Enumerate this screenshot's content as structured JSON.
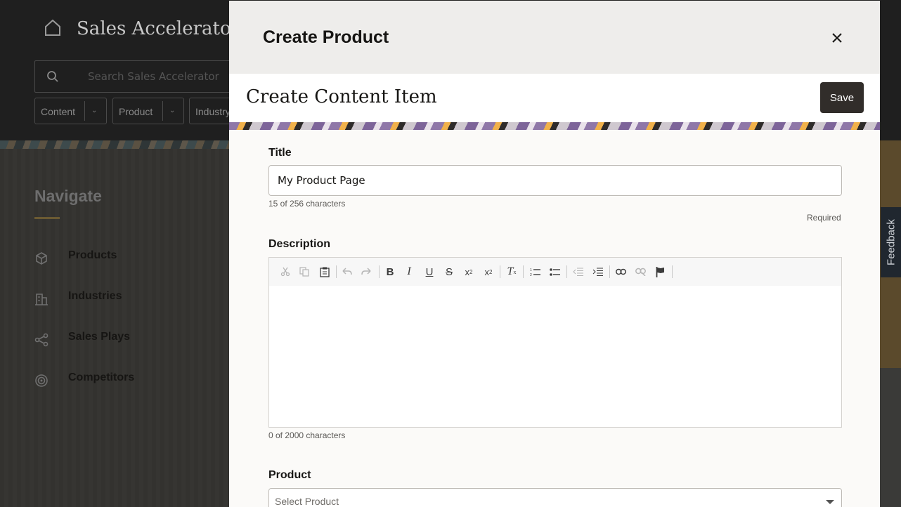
{
  "background": {
    "app_title": "Sales Accelerator",
    "search_placeholder": "Search Sales Accelerator",
    "filters": [
      {
        "label": "Content"
      },
      {
        "label": "Product"
      },
      {
        "label": "Industry"
      }
    ],
    "nav": {
      "title": "Navigate",
      "items": [
        {
          "label": "Products",
          "icon": "cube-icon"
        },
        {
          "label": "Industries",
          "icon": "building-icon"
        },
        {
          "label": "Sales Plays",
          "icon": "share-icon"
        },
        {
          "label": "Competitors",
          "icon": "target-icon"
        }
      ]
    },
    "feedback_label": "Feedback"
  },
  "modal": {
    "title": "Create Product",
    "close_icon": "close-icon",
    "content_item": {
      "heading": "Create Content Item",
      "save_label": "Save"
    },
    "form": {
      "title": {
        "label": "Title",
        "value": "My Product Page",
        "counter": "15 of 256 characters",
        "required": "Required"
      },
      "description": {
        "label": "Description",
        "counter": "0 of 2000 characters",
        "toolbar": [
          "cut-icon",
          "copy-icon",
          "paste-icon",
          "undo-icon",
          "redo-icon",
          "bold-icon",
          "italic-icon",
          "underline-icon",
          "strikethrough-icon",
          "subscript-icon",
          "superscript-icon",
          "remove-format-icon",
          "numbered-list-icon",
          "bulleted-list-icon",
          "outdent-icon",
          "indent-icon",
          "link-icon",
          "unlink-icon",
          "flag-icon"
        ]
      },
      "product": {
        "label": "Product",
        "placeholder": "Select Product"
      }
    }
  },
  "colors": {
    "primary_button": "#312d2a",
    "header_bg": "#eeedeb",
    "form_bg": "#fbfaf8"
  }
}
